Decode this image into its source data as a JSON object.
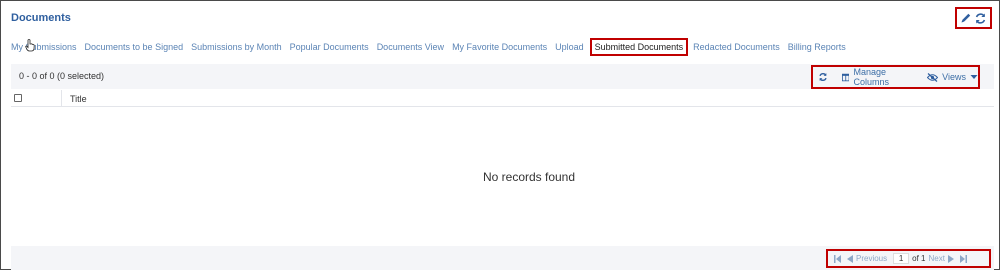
{
  "header": {
    "title": "Documents"
  },
  "tabs": [
    {
      "label": "My Submissions",
      "active": false
    },
    {
      "label": "Documents to be Signed",
      "active": false
    },
    {
      "label": "Submissions by Month",
      "active": false
    },
    {
      "label": "Popular Documents",
      "active": false
    },
    {
      "label": "Documents View",
      "active": false
    },
    {
      "label": "My Favorite Documents",
      "active": false
    },
    {
      "label": "Upload",
      "active": false
    },
    {
      "label": "Submitted Documents",
      "active": true
    },
    {
      "label": "Redacted Documents",
      "active": false
    },
    {
      "label": "Billing Reports",
      "active": false
    }
  ],
  "toolbar": {
    "selection_count": "0 - 0 of 0 (0 selected)",
    "manage_columns_label": "Manage Columns",
    "views_label": "Views"
  },
  "table": {
    "columns": [
      "Title"
    ],
    "empty_message": "No records found"
  },
  "pagination": {
    "previous_label": "Previous",
    "current_page": "1",
    "of_label": "of 1",
    "next_label": "Next"
  },
  "icons": {
    "edit": "pencil-icon",
    "refresh": "refresh-icon",
    "columns": "columns-icon",
    "views": "eye-slash-icon",
    "views_dropdown": "caret-down-icon",
    "first": "first-page-icon",
    "prev": "prev-page-icon",
    "next": "next-page-icon",
    "last": "last-page-icon"
  },
  "colors": {
    "accent": "#2f5f9f",
    "link": "#5b84b5",
    "highlight_border": "#c00000",
    "toolbar_bg": "#f4f5f8"
  }
}
